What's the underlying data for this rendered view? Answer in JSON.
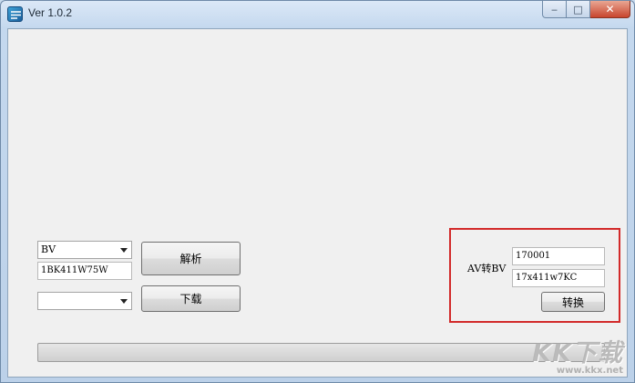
{
  "window": {
    "title": "Ver 1.0.2",
    "icon": "app-icon",
    "caption": {
      "minimize": "‒",
      "maximize": "□",
      "close": "✕"
    }
  },
  "download": {
    "type_select": {
      "selected": "BV"
    },
    "id_input": {
      "value": "1BK411W75W"
    },
    "parse_button": "解析",
    "quality_select": {
      "selected": ""
    },
    "download_button": "下载"
  },
  "converter": {
    "label": "AV转BV",
    "av_input": {
      "value": "170001"
    },
    "bv_input": {
      "value": "17x411w7KC"
    },
    "convert_button": "转换",
    "highlight_color": "#d22a2a"
  },
  "progress": {
    "value": 0.0
  },
  "watermark": {
    "main": "KK下载",
    "sub": "www.kkx.net"
  }
}
